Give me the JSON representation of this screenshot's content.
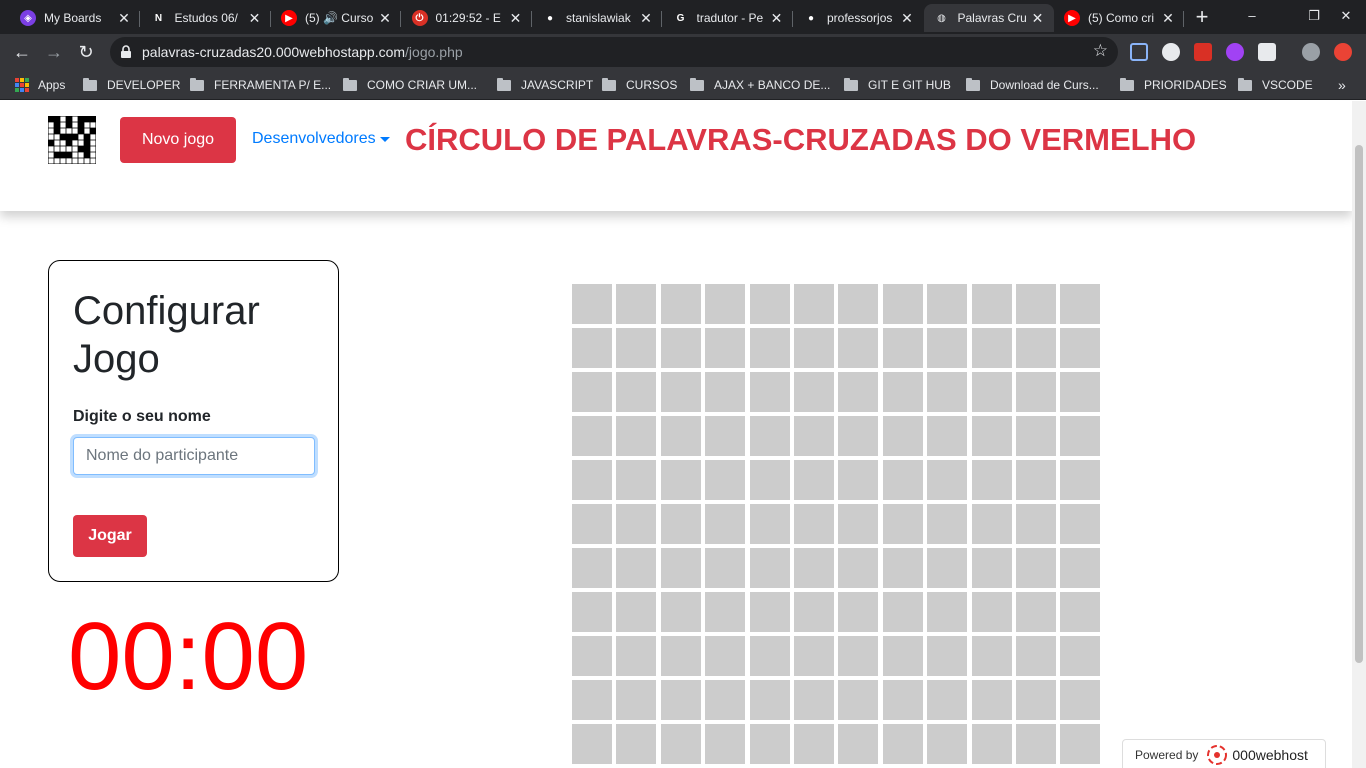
{
  "browser": {
    "tabs": [
      {
        "title": "My Boards",
        "color": "#7b3fe4",
        "glyph": "◈"
      },
      {
        "title": "Estudos 06/",
        "color": "#ffffff",
        "glyph": "N"
      },
      {
        "title": "(5) 🔊 Curso",
        "color": "#ff0000",
        "glyph": "▶"
      },
      {
        "title": "01:29:52 - E",
        "color": "#d93025",
        "glyph": "⏻"
      },
      {
        "title": "stanislawiak",
        "color": "#ffffff",
        "glyph": "●"
      },
      {
        "title": "tradutor - Pe",
        "color": "#ffffff",
        "glyph": "G"
      },
      {
        "title": "professorjos",
        "color": "#ffffff",
        "glyph": "●"
      },
      {
        "title": "Palavras Cru",
        "color": "#e8eaed",
        "glyph": "◍"
      },
      {
        "title": "(5) Como cri",
        "color": "#ff0000",
        "glyph": "▶"
      }
    ],
    "active_tab": 7,
    "new_tab": "+",
    "window_controls": [
      "–",
      "❐",
      "✕"
    ],
    "url_domain": "palavras-cruzadas20.000webhostapp.com",
    "url_path": "/jogo.php",
    "bookmark_apps": "Apps",
    "bookmarks": [
      "DEVELOPER",
      "FERRAMENTA P/ E...",
      "COMO CRIAR UM...",
      "JAVASCRIPT",
      "CURSOS",
      "AJAX + BANCO DE...",
      "GIT E GIT HUB",
      "Download de Curs...",
      "PRIORIDADES",
      "VSCODE"
    ],
    "bookmarks_more": "»"
  },
  "header": {
    "new_game": "Novo jogo",
    "developers": "Desenvolvedores",
    "title": "CÍRCULO DE PALAVRAS-CRUZADAS DO VERMELHO"
  },
  "config": {
    "title": "Configurar Jogo",
    "name_label": "Digite o seu nome",
    "name_placeholder": "Nome do participante",
    "name_value": "",
    "play": "Jogar"
  },
  "timer": "00:00",
  "board": {
    "columns": 12,
    "visible_rows": 11,
    "cell_color": "#cccccc"
  },
  "colors": {
    "accent_red": "#dc3545",
    "link_blue": "#007bff",
    "timer_red": "#ff0000"
  },
  "footer": {
    "powered_by": "Powered by",
    "host": "000webhost"
  }
}
